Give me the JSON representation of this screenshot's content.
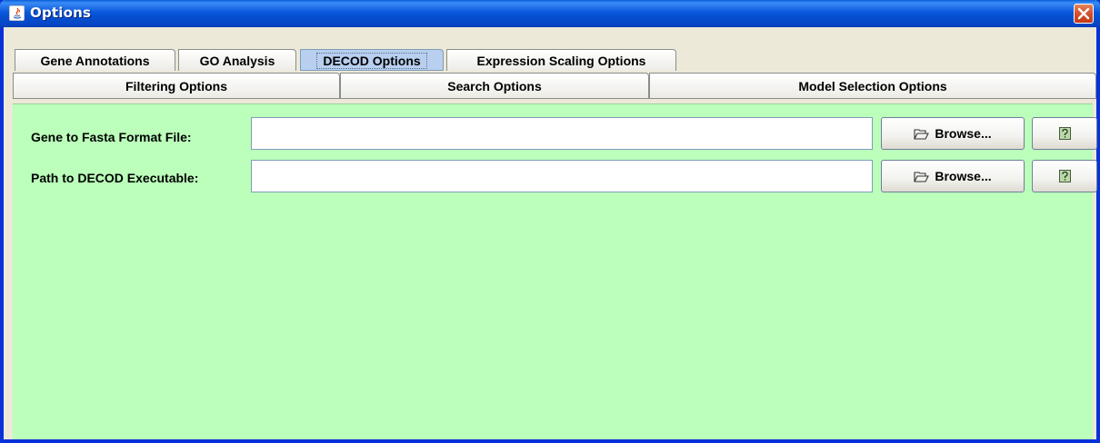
{
  "window": {
    "title": "Options"
  },
  "tabs": {
    "row1": [
      {
        "label": "Gene Annotations"
      },
      {
        "label": "GO Analysis"
      },
      {
        "label": "DECOD Options",
        "selected": true
      },
      {
        "label": "Expression Scaling Options"
      }
    ],
    "row2": [
      {
        "label": "Filtering Options"
      },
      {
        "label": "Search Options"
      },
      {
        "label": "Model Selection Options"
      }
    ]
  },
  "form": {
    "fasta": {
      "label": "Gene to Fasta Format File:",
      "value": "",
      "browse_label": "Browse..."
    },
    "decod": {
      "label": "Path to DECOD Executable:",
      "value": "",
      "browse_label": "Browse..."
    }
  },
  "colors": {
    "panel_background": "#bbffbb",
    "titlebar_blue": "#0b58dd",
    "selected_tab": "#b8cff0"
  },
  "icons": {
    "title": "java-app-icon",
    "close": "close-icon",
    "browse": "folder-open-icon",
    "help": "help-icon"
  }
}
